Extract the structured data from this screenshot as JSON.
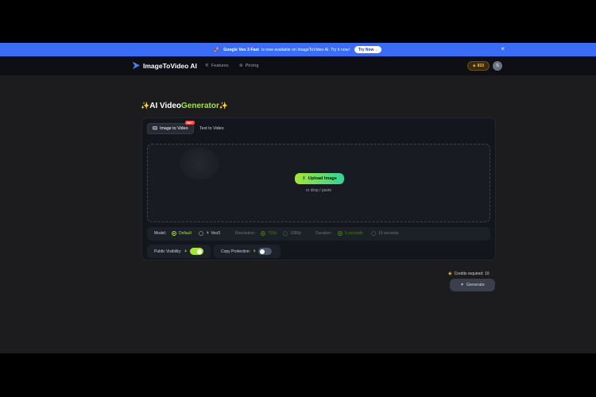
{
  "announcement": {
    "product": "Google Veo 3 Fast",
    "message": "is now available on ImageToVideo AI. Try it now!",
    "cta": "Try Now→",
    "close": "×"
  },
  "header": {
    "logo": "ImageToVideo AI",
    "nav": [
      {
        "label": "Features",
        "icon": "features-icon"
      },
      {
        "label": "Pricing",
        "icon": "pricing-icon"
      }
    ],
    "credits": "810",
    "avatar_initial": "S"
  },
  "main": {
    "title_spark_left": "✨",
    "title_part1": "AI Video",
    "title_part2": "Generator",
    "title_spark_right": "✨",
    "tabs": [
      {
        "label": "Image to Video",
        "badge": "HOT"
      },
      {
        "label": "Text to Video"
      }
    ],
    "upload": {
      "button": "Upload Image",
      "hint": "or drop / paste"
    },
    "options": {
      "model_label": "Model:",
      "model_default": "Default",
      "model_veo": "Veo3",
      "resolution_label": "Resolution:",
      "res_720": "720p",
      "res_1080": "1080p",
      "duration_label": "Duration:",
      "dur_5": "5 seconds",
      "dur_10": "10 seconds",
      "public_label": "Public Visibility:",
      "copy_label": "Copy Protection:"
    },
    "credits_required": "Credits required: 10",
    "generate": "Generate"
  },
  "colors": {
    "accent_green": "#a3e635",
    "banner_blue": "#3b6cf5"
  }
}
